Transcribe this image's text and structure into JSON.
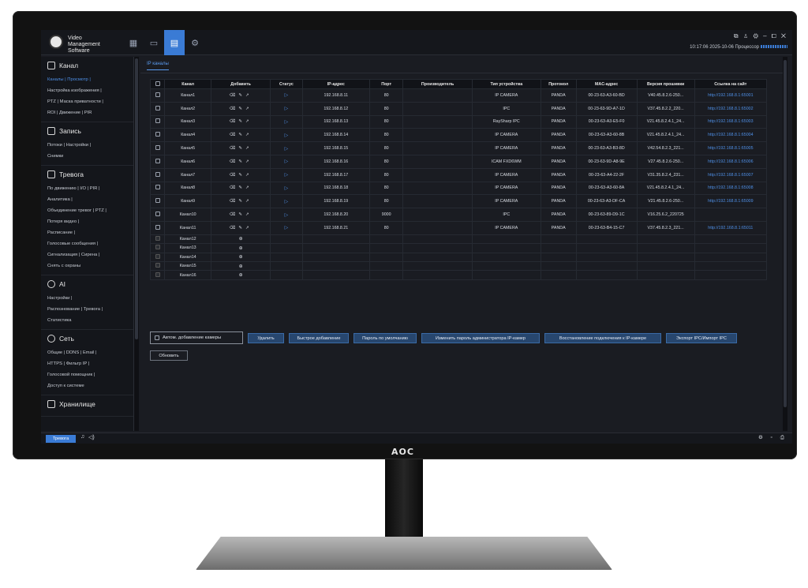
{
  "app": {
    "title_line1": "Video Management",
    "title_line2": "Software"
  },
  "window_controls": "⧉ ♙ ⚙ – ⧠ ✕",
  "top_icons": [
    "grid-icon",
    "camera-icon",
    "display-icon",
    "settings-icon"
  ],
  "clock_text": "10:17:06 2025-10-06 Процессор",
  "cpu_meter": 0.95,
  "brand": "AOC",
  "sidebar": {
    "sections": [
      {
        "title": "Канал",
        "icon": "channel-icon",
        "links": [
          "Каналы | Просмотр |",
          "Настройка изображения |",
          "PTZ | Маска приватности |",
          "ROI | Движение | PIR"
        ]
      },
      {
        "title": "Запись",
        "icon": "record-icon",
        "links": [
          "Потоки | Настройки |",
          "Снимки"
        ]
      },
      {
        "title": "Тревога",
        "icon": "alarm-icon",
        "links": [
          "По движению | I/O | PIR |",
          "Аналитика |",
          "Объединение тревог | PTZ |",
          "Потеря видео |",
          "Расписание |",
          "Голосовые сообщения |",
          "Сигнализация | Сирена |",
          "Снять с охраны"
        ]
      },
      {
        "title": "AI",
        "icon": "ai-icon",
        "links": [
          "Настройки |",
          "Распознование | Тревога |",
          "Статистика"
        ]
      },
      {
        "title": "Сеть",
        "icon": "network-icon",
        "links": [
          "Общие | DDNS | Email |",
          "HTTPS | Фильтр IP |",
          "Голосовой помощник |",
          "Доступ к системе"
        ]
      },
      {
        "title": "Хранилище",
        "icon": "storage-icon",
        "links": []
      }
    ]
  },
  "tab_label": "IP каналы",
  "table": {
    "headers": [
      "",
      "Канал",
      "Добавить",
      "Статус",
      "IP-адрес",
      "Порт",
      "Производитель",
      "Тип устройства",
      "Протокол",
      "MAC-адрес",
      "Версия прошивки",
      "Ссылка на сайт"
    ],
    "rows": [
      {
        "name": "Канал1",
        "ip": "192.168.8.11",
        "port": "80",
        "maker": "",
        "type": "IP CAMERA",
        "proto": "PANDA",
        "mac": "00-23-63-A3-60-BD",
        "fw": "V40.45.8.2.6-250...",
        "url": "http://192.168.8.1:65001"
      },
      {
        "name": "Канал2",
        "ip": "192.168.8.12",
        "port": "80",
        "maker": "",
        "type": "IPC",
        "proto": "PANDA",
        "mac": "00-23-63-9D-A7-1D",
        "fw": "V37.45.8.2.2_220...",
        "url": "http://192.168.8.1:65002"
      },
      {
        "name": "Канал3",
        "ip": "192.168.8.13",
        "port": "80",
        "maker": "",
        "type": "RaySharp IPC",
        "proto": "PANDA",
        "mac": "00-23-63-A3-E5-F0",
        "fw": "V21.45.8.2.4.1_24...",
        "url": "http://192.168.8.1:65003"
      },
      {
        "name": "Канал4",
        "ip": "192.168.8.14",
        "port": "80",
        "maker": "",
        "type": "IP CAMERA",
        "proto": "PANDA",
        "mac": "00-23-63-A3-60-8B",
        "fw": "V21.45.8.2.4.1_24...",
        "url": "http://192.168.8.1:65004"
      },
      {
        "name": "Канал5",
        "ip": "192.168.8.15",
        "port": "80",
        "maker": "",
        "type": "IP CAMERA",
        "proto": "PANDA",
        "mac": "00-23-63-A3-B3-8D",
        "fw": "V42.54.8.2.3_221...",
        "url": "http://192.168.8.1:65005"
      },
      {
        "name": "Канал6",
        "ip": "192.168.8.16",
        "port": "80",
        "maker": "",
        "type": "ICAM FXD6WM",
        "proto": "PANDA",
        "mac": "00-23-63-9D-A8-9E",
        "fw": "V27.45.8.2.6-250...",
        "url": "http://192.168.8.1:65006"
      },
      {
        "name": "Канал7",
        "ip": "192.168.8.17",
        "port": "80",
        "maker": "",
        "type": "IP CAMERA",
        "proto": "PANDA",
        "mac": "00-23-63-A4-22-2F",
        "fw": "V31.35.8.2.4_231...",
        "url": "http://192.168.8.1:65007"
      },
      {
        "name": "Канал8",
        "ip": "192.168.8.18",
        "port": "80",
        "maker": "",
        "type": "IP CAMERA",
        "proto": "PANDA",
        "mac": "00-23-63-A3-60-8A",
        "fw": "V21.45.8.2.4.1_24...",
        "url": "http://192.168.8.1:65008"
      },
      {
        "name": "Канал9",
        "ip": "192.168.8.19",
        "port": "80",
        "maker": "",
        "type": "IP CAMERA",
        "proto": "PANDA",
        "mac": "00-23-63-A3-DF-CA",
        "fw": "V21.45.8.2.6-250...",
        "url": "http://192.168.8.1:65009"
      },
      {
        "name": "Канал10",
        "ip": "192.168.8.20",
        "port": "9000",
        "maker": "",
        "type": "IPC",
        "proto": "PANDA",
        "mac": "00-23-63-89-D9-1C",
        "fw": "V16.25.6.2_220725",
        "url": ""
      },
      {
        "name": "Канал11",
        "ip": "192.168.8.21",
        "port": "80",
        "maker": "",
        "type": "IP CAMERA",
        "proto": "PANDA",
        "mac": "00-23-63-B4-15-C7",
        "fw": "V37.45.8.2.3_221...",
        "url": "http://192.168.8.1:65011"
      }
    ],
    "empty_rows": [
      "Канал12",
      "Канал13",
      "Канал14",
      "Канал15",
      "Канал16"
    ]
  },
  "buttons": {
    "auto_add": "Автом. добавление камеры",
    "delete": "Удалить",
    "quick_add": "Быстрое добавление",
    "default_password": "Пароль по умолчанию",
    "change_admin_password": "Изменить пароль администратора IP-камер",
    "restore_connection": "Восстановление подключения к IP-камере",
    "export_import": "Экспорт IPC/Импорт IPC",
    "refresh": "Обновить"
  },
  "statusbar": {
    "alarm": "Тревога",
    "right_icons": "⚙ ▫ ⎙"
  }
}
